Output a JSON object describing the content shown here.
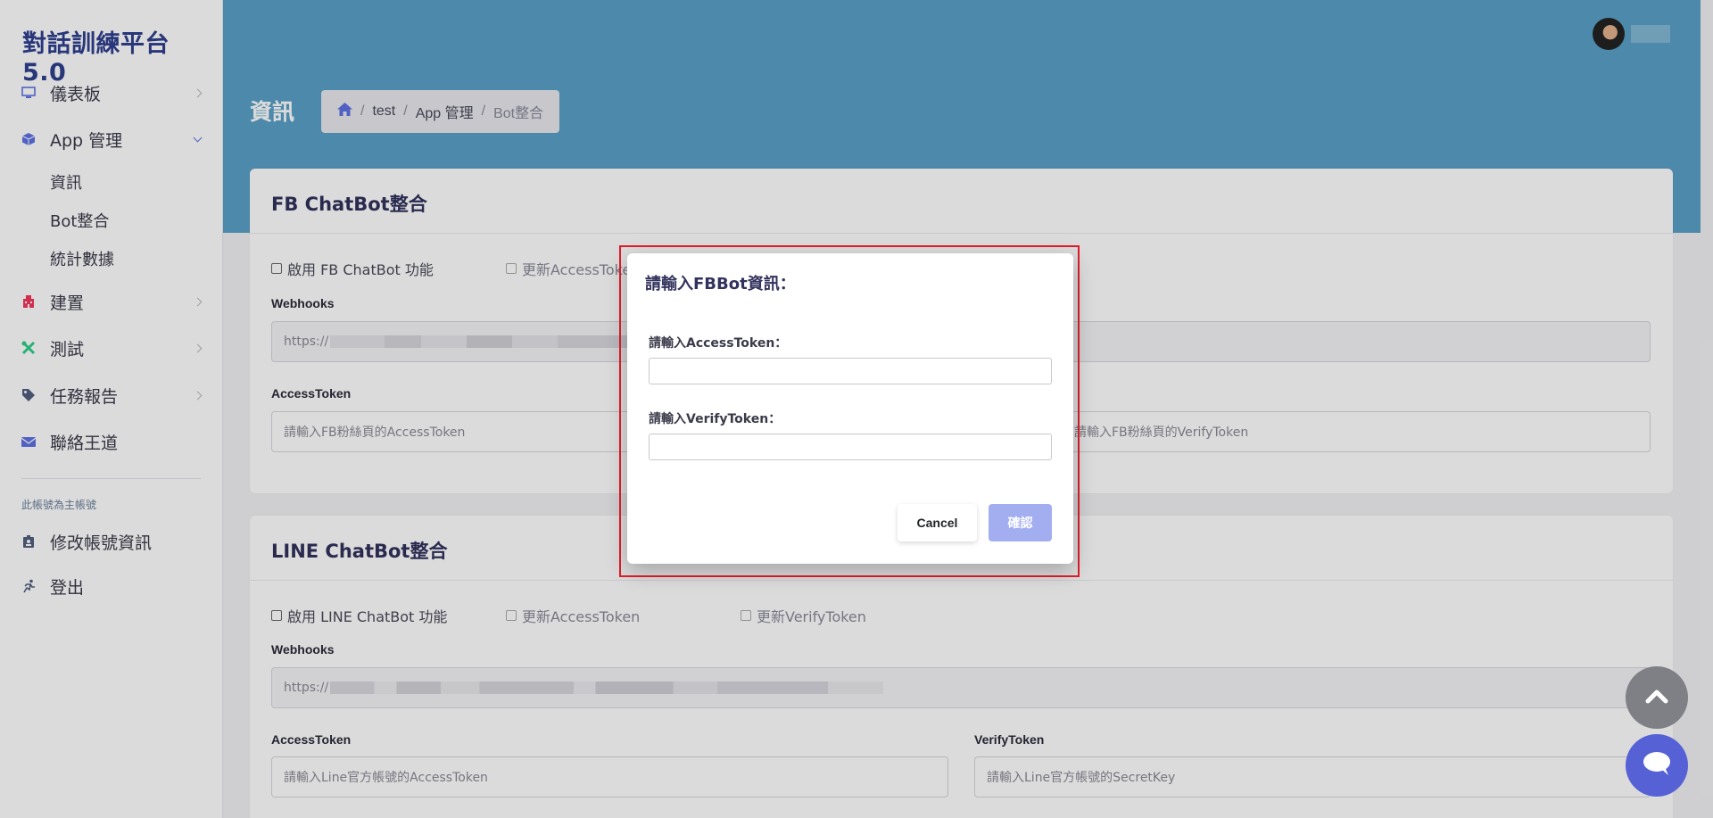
{
  "app": {
    "title": "對話訓練平台 5.0"
  },
  "sidebar": {
    "items": [
      {
        "label": "儀表板",
        "icon": "monitor-icon"
      },
      {
        "label": "App 管理",
        "icon": "cube-icon"
      },
      {
        "label": "建置",
        "icon": "building-icon"
      },
      {
        "label": "測試",
        "icon": "tools-icon"
      },
      {
        "label": "任務報告",
        "icon": "tag-icon"
      },
      {
        "label": "聯絡王道",
        "icon": "envelope-icon"
      }
    ],
    "sub_items": [
      {
        "label": "資訊"
      },
      {
        "label": "Bot整合"
      },
      {
        "label": "統計數據"
      }
    ],
    "account_heading": "此帳號為主帳號",
    "account_items": [
      {
        "label": "修改帳號資訊",
        "icon": "id-badge-icon"
      },
      {
        "label": "登出",
        "icon": "running-icon"
      }
    ]
  },
  "header": {
    "page_title": "資訊",
    "breadcrumb": [
      "test",
      "App 管理",
      "Bot整合"
    ]
  },
  "fb_card": {
    "title": "FB ChatBot整合",
    "enable_label": "啟用 FB ChatBot 功能",
    "update_access_label": "更新AccessToken",
    "webhooks_label": "Webhooks",
    "webhooks_value": "https://",
    "access_label": "AccessToken",
    "access_placeholder": "請輸入FB粉絲頁的AccessToken",
    "verify_placeholder": "請輸入FB粉絲頁的VerifyToken"
  },
  "line_card": {
    "title": "LINE ChatBot整合",
    "enable_label": "啟用 LINE ChatBot 功能",
    "update_access_label": "更新AccessToken",
    "update_verify_label": "更新VerifyToken",
    "webhooks_label": "Webhooks",
    "webhooks_value": "https://",
    "access_label": "AccessToken",
    "verify_label": "VerifyToken",
    "access_placeholder": "請輸入Line官方帳號的AccessToken",
    "verify_placeholder": "請輸入Line官方帳號的SecretKey"
  },
  "modal": {
    "title": "請輸入FBBot資訊：",
    "access_label": "請輸入AccessToken：",
    "verify_label": "請輸入VerifyToken：",
    "access_value": "",
    "verify_value": "",
    "cancel_label": "Cancel",
    "confirm_label": "確認"
  },
  "colors": {
    "header_bg": "#5aa0c6",
    "brand": "#2f3f8f",
    "confirm_button": "#a3aef0",
    "chat_button": "#5661d6",
    "highlight_frame": "#e11d2a"
  }
}
